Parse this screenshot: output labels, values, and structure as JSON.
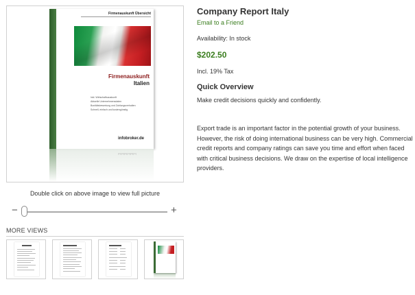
{
  "product": {
    "title": "Company Report Italy",
    "email_link": "Email to a Friend",
    "availability": "Availability: In stock",
    "price": "$202.50",
    "tax": "Incl. 19% Tax",
    "overview_title": "Quick Overview",
    "overview_text": "Make credit decisions quickly and confidently.",
    "description": "Export trade is an important factor in the potential growth of your business. However, the risk of doing international business can be very high. Commercial credit reports and company ratings can save you time and effort when faced with critical business decisions. We draw on the expertise of local intelligence providers."
  },
  "main_image": {
    "header": "Firmenauskunft Übersicht",
    "title": "Firmenauskunft",
    "subtitle": "Italien",
    "lines": [
      "Inkl. Wirtschaftsauskunft",
      "Aktuelle Unternehmensdaten",
      "Bonitätsbewertung und Zahlungsverhalten",
      "Schnell, einfach und kostengünstig"
    ],
    "brand": "infobroker.de",
    "footnote": "pqpqpqpqpqpq"
  },
  "caption": "Double click on above image to view full picture",
  "zoom": {
    "minus": "−",
    "plus": "+",
    "level": 0
  },
  "more_views": {
    "title": "MORE VIEWS",
    "thumbnails": [
      "report-page-1",
      "report-page-2",
      "report-page-3",
      "report-cover"
    ]
  },
  "colors": {
    "accent_green": "#3a7d1e",
    "spine_green": "#3b6b35"
  }
}
